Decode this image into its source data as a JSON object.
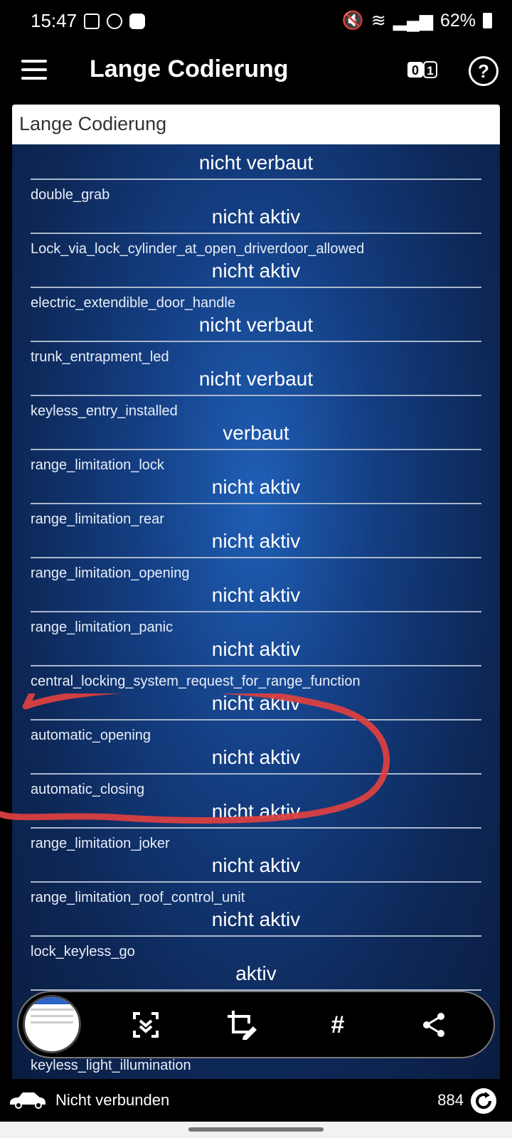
{
  "status_bar": {
    "time": "15:47",
    "battery": "62%"
  },
  "app_bar": {
    "title": "Lange Codierung"
  },
  "search": {
    "value": "Lange Codierung"
  },
  "rows": [
    {
      "label": "",
      "value": "nicht verbaut"
    },
    {
      "label": "double_grab",
      "value": "nicht aktiv"
    },
    {
      "label": "Lock_via_lock_cylinder_at_open_driverdoor_allowed",
      "value": "nicht aktiv"
    },
    {
      "label": "electric_extendible_door_handle",
      "value": "nicht verbaut"
    },
    {
      "label": "trunk_entrapment_led",
      "value": "nicht verbaut"
    },
    {
      "label": "keyless_entry_installed",
      "value": "verbaut"
    },
    {
      "label": "range_limitation_lock",
      "value": "nicht aktiv"
    },
    {
      "label": "range_limitation_rear",
      "value": "nicht aktiv"
    },
    {
      "label": "range_limitation_opening",
      "value": "nicht aktiv"
    },
    {
      "label": "range_limitation_panic",
      "value": "nicht aktiv"
    },
    {
      "label": "central_locking_system_request_for_range_function",
      "value": "nicht aktiv"
    },
    {
      "label": "automatic_opening",
      "value": "nicht aktiv"
    },
    {
      "label": "automatic_closing",
      "value": "nicht aktiv"
    },
    {
      "label": "range_limitation_joker",
      "value": "nicht aktiv"
    },
    {
      "label": "range_limitation_roof_control_unit",
      "value": "nicht aktiv"
    },
    {
      "label": "lock_keyless_go",
      "value": "aktiv"
    }
  ],
  "below_toolbar_label": "keyless_light_illumination",
  "footer": {
    "connection": "Nicht verbunden",
    "count": "884"
  },
  "colors": {
    "highlight": "#e0403f",
    "panel": "#143e82"
  }
}
